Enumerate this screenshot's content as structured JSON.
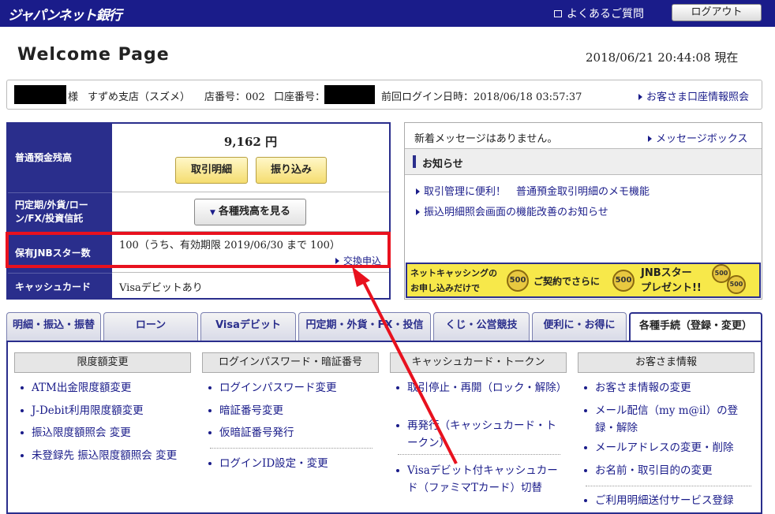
{
  "header": {
    "logo": "ジャパンネット銀行",
    "faq": "よくあるご質問",
    "logout": "ログアウト"
  },
  "page": {
    "title": "Welcome Page",
    "datetime": "2018/06/21 20:44:08 現在"
  },
  "userbar": {
    "honorific": "様",
    "branch": "すずめ支店（スズメ）",
    "branch_no": "店番号：002",
    "account_label": "口座番号：",
    "last_login": "前回ログイン日時：2018/06/18 03:57:37",
    "account_info_link": "お客さま口座情報照会"
  },
  "balance_panel": {
    "savings_label": "普通預金残高",
    "savings_amount": "9,162 円",
    "history_button": "取引明細",
    "transfer_button": "振り込み",
    "other_label": "円定期/外貨/ローン/FX/投資信託",
    "view_balances_button": "各種残高を見る",
    "stars_label": "保有JNBスター数",
    "stars_value": "100（うち、有効期限 2019/06/30 まで 100）",
    "exchange_link": "交換申込",
    "card_label": "キャッシュカード",
    "card_value": "Visaデビットあり"
  },
  "messages": {
    "new_message": "新着メッセージはありません。",
    "message_box_link": "メッセージボックス",
    "notice_heading": "お知らせ",
    "notices": [
      "取引管理に便利！　普通預金取引明細のメモ機能",
      "振込明細照会画面の機能改善のお知らせ"
    ],
    "banner_line1": "ネットキャッシングの",
    "banner_line2": "お申し込みだけで",
    "banner_coin": "500",
    "banner_mid": "ご契約でさらに",
    "banner_coin2": "500",
    "banner_right1": "JNBスター",
    "banner_right2": "プレゼント!!"
  },
  "tabs": [
    "明細・振込・振替",
    "ローン",
    "Visaデビット",
    "円定期・外貨・FX・投信",
    "くじ・公営競技",
    "便利に・お得に",
    "各種手続（登録・変更）"
  ],
  "columns": [
    {
      "heading": "限度額変更",
      "items": [
        "ATM出金限度額変更",
        "J-Debit利用限度額変更",
        "振込限度額照会 変更",
        "未登録先 振込限度額照会 変更"
      ]
    },
    {
      "heading": "ログインパスワード・暗証番号",
      "items": [
        "ログインパスワード変更",
        "暗証番号変更",
        "仮暗証番号発行",
        "ログインID設定・変更"
      ]
    },
    {
      "heading": "キャッシュカード・トークン",
      "items": [
        "取引停止・再開（ロック・解除）",
        "再発行（キャッシュカード・トークン）",
        "Visaデビット付キャッシュカード（ファミマTカード）切替"
      ]
    },
    {
      "heading": "お客さま情報",
      "items": [
        "お客さま情報の変更",
        "メール配信（my m@il）の登録・解除",
        "メールアドレスの変更・削除",
        "お名前・取引目的の変更",
        "ご利用明細送付サービス登録"
      ]
    }
  ],
  "colors": {
    "navy": "#1a1c8a",
    "highlight_red": "#e8111e",
    "button_yellow": "#f5dd70"
  }
}
